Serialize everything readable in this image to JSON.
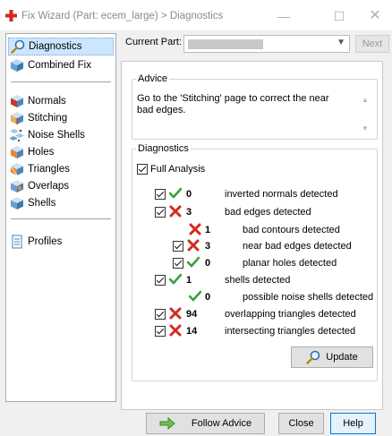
{
  "window": {
    "title": "Fix Wizard (Part: ecem_large) > Diagnostics",
    "minimize": "—",
    "maximize": "☐",
    "close": "✕"
  },
  "sidebar": {
    "items": [
      {
        "label": "Diagnostics",
        "icon": "magnifier-icon",
        "selected": true
      },
      {
        "label": "Combined Fix",
        "icon": "cube-icon"
      },
      {
        "label": "Normals",
        "icon": "normals-cube-icon"
      },
      {
        "label": "Stitching",
        "icon": "stitching-cube-icon"
      },
      {
        "label": "Noise Shells",
        "icon": "noise-shells-icon"
      },
      {
        "label": "Holes",
        "icon": "holes-cube-icon"
      },
      {
        "label": "Triangles",
        "icon": "triangles-cube-icon"
      },
      {
        "label": "Overlaps",
        "icon": "overlaps-cube-icon"
      },
      {
        "label": "Shells",
        "icon": "shells-cube-icon"
      },
      {
        "label": "Profiles",
        "icon": "document-icon"
      }
    ]
  },
  "current_part": {
    "label": "Current Part:",
    "value": "",
    "next_label": "Next"
  },
  "advice": {
    "legend": "Advice",
    "text": "Go to the 'Stitching' page to correct the near bad edges."
  },
  "diagnostics": {
    "legend": "Diagnostics",
    "full_analysis_label": "Full Analysis",
    "full_analysis_checked": true,
    "rows": [
      {
        "status": "ok",
        "count": "0",
        "text": "inverted normals detected",
        "has_checkbox": true
      },
      {
        "status": "error",
        "count": "3",
        "text": "bad edges detected",
        "has_checkbox": true
      },
      {
        "status": "error",
        "count": "1",
        "text": "bad contours detected",
        "has_checkbox": false
      },
      {
        "status": "error",
        "count": "3",
        "text": "near bad edges detected",
        "has_checkbox": true
      },
      {
        "status": "ok",
        "count": "0",
        "text": "planar holes detected",
        "has_checkbox": true
      },
      {
        "status": "ok",
        "count": "1",
        "text": "shells detected",
        "has_checkbox": true
      },
      {
        "status": "ok",
        "count": "0",
        "text": "possible noise shells detected",
        "has_checkbox": false
      },
      {
        "status": "error",
        "count": "94",
        "text": "overlapping triangles detected",
        "has_checkbox": true
      },
      {
        "status": "error",
        "count": "14",
        "text": "intersecting triangles detected",
        "has_checkbox": true
      }
    ],
    "update_label": "Update"
  },
  "footer": {
    "follow_advice_label": "Follow Advice",
    "close_label": "Close",
    "help_label": "Help"
  },
  "colors": {
    "ok": "#3aa13a",
    "error": "#d12b1f",
    "selection": "#cce6ff",
    "help_border": "#0078d7"
  }
}
